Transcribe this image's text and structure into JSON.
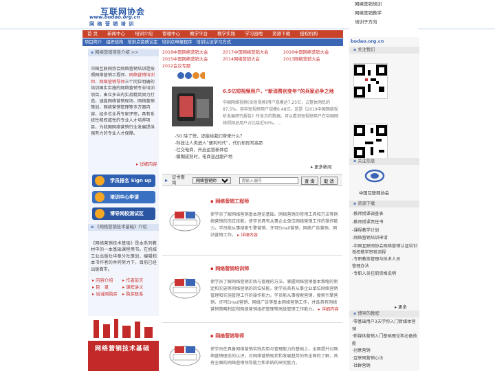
{
  "header": {
    "logo_cn": "互联网协会",
    "logo_url": "www.bodao.org.cn",
    "logo_sub": "网 络 营 销 培 训",
    "top_links": [
      "网络营销培训",
      "网络营销教学",
      "培训子方向"
    ]
  },
  "nav": [
    "首 页",
    "新闻中心",
    "培训介绍",
    "管理中心",
    "教学平台",
    "教学实践",
    "学习园地",
    "资源下载",
    "授权机构"
  ],
  "subnav": [
    "项目简介",
    "组织结构",
    "培训点资质认定",
    "培训点申报程序",
    "培训认证学习方式"
  ],
  "left": {
    "intro_header": "网络营销项目介绍 >>",
    "intro_text_before": "中国互联网协会网络营销培训是按照网络营销工程师、",
    "intro_highlight": "网络营销培训师、网络营销导师",
    "intro_text_after": "三个岗位明确的培训国实实施的网络营销专业培训项目，由众多业内实战精英倾力打造，涵盖网络营销现场、网络营销策划、网络营销管理等多方面内容，经多位业界专家评审，具有系统性和权威性的专业人才培养项目，为我国网络营销行业发展提供强有力的专业人才保障。",
    "intro_more": "详细内容",
    "buttons": [
      "学员报名 Sign up",
      "培训中心申请",
      "博导网校测试区"
    ],
    "book_header": "《网络营销技术基础》介绍",
    "book_desc": "《网络营销技术基础》是本系列教材中的一本基础课程用书。在机械工业出版社华章分社策划、编辑和本书作者的共同努力下，目前已经出版面市。",
    "book_links": [
      "内容介绍",
      "作者前言",
      "目　录",
      "课程讲义",
      "当当网购买",
      "购买联系"
    ],
    "book_cover_title": "网络营销技术基础"
  },
  "center": {
    "topics": [
      "2018中国网络营销大会",
      "2017中国网络营销大会",
      "2016中国网络营销大会",
      "2015中国网络营销大会",
      "2014网络营销大会",
      "2013网络营销大会",
      "2012会议专题"
    ],
    "news_title": "6.5亿短视频用户，“新消费创变年”的兵家必争之地",
    "news_body": "中国网络视频(含短视频)用户规模达7.25亿，占整体网民的87.5%，其中短视频用户规模6.48亿。这是《2019中国网络视听发展研究报告》所显示的数据。可以看到短视频用户在中国网络视频总用户占比接近90%。...",
    "news_list": [
      "-5G 除了快，还能给我们带来什么？",
      "-科技让人类进入“便利时代”，代价却异常高昂",
      "-社交电商，开启运营新体验",
      "-模糊成熟时，电商混战跟产地"
    ],
    "news_more": "更多新闻",
    "cert": {
      "label": "证书查询",
      "select_value": "网络营销师",
      "input_placeholder": "请输入编号",
      "query_button": "查 询",
      "cancel_button": "取 消"
    },
    "programs": [
      {
        "title": "网络营销工程师",
        "desc": "使学员了解网络营销基本理论基础、网络营销的常用工具和方法等网络营销的岗位技能。使学员具有从事企业单位网络营销工作的操作能力。学员能从事搜索引擎营销、许可Email营销、网络广告营销、网站营销工作。",
        "more": "详细内容"
      },
      {
        "title": "网络营销培训师",
        "desc": "使学员了解网络营销实践与管理的方法、掌握网络营销基本策略的制定和实施等网络营销的岗位技能。使学员具有从事企业单位网络营销管理和实施管理工作的操作能力。学员能从事搜索营销、搜索引擎营销、许可Email营销、网络广告等基本网络营销工作，并且具有网络营销策略制定和网络营销组织管理等高级管理工作能力。",
        "more": "详细内容"
      },
      {
        "title": "网络营销导师",
        "desc": "使学员在具备网络营销实践应用与管理能力的基础上，全面提升对网络营销理念的认识，对网络营销现状和发展趋势的有全面的了解，具有全面的网络营销领导能力和系统的研究能力。",
        "more": ""
      }
    ]
  },
  "right": {
    "site_logo": "bodao.org.cn",
    "follow_header": "关注我们",
    "follow2_header": "关注信息",
    "assoc_name": "中国互联网协会",
    "download_header": "资源下载",
    "downloads": [
      "-教师授课调查表",
      "-教师授课责任书",
      "-课程教学计划",
      "-网络营销培训申请",
      "-中国互联网协会网络营销认证培训授权教学审核流程",
      "-专职教务管理与技术人员",
      "管理办法",
      "-专职人员任职资格说明"
    ],
    "downloads_more": "更多",
    "tips_header": "博导的教程",
    "tips": [
      "·零基础用户3天学你入门新媒体营销",
      "·新媒体营销入门基础理论和必备技能",
      "·创意营销",
      "·互联网营销心法",
      "·社群营销"
    ]
  }
}
